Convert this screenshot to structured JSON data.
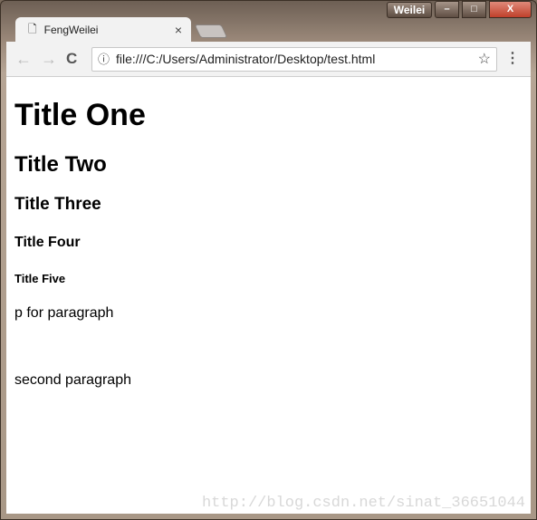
{
  "window": {
    "user": "Weilei",
    "min": "–",
    "max": "□",
    "close": "X"
  },
  "tab": {
    "title": "FengWeilei",
    "close": "×"
  },
  "toolbar": {
    "back": "←",
    "forward": "→",
    "reload": "C",
    "url": "file:///C:/Users/Administrator/Desktop/test.html",
    "info": "ⓘ",
    "star": "☆",
    "menu": "⋮"
  },
  "page": {
    "h1": "Title One",
    "h2": "Title Two",
    "h3": "Title Three",
    "h4": "Title Four",
    "h5": "Title Five",
    "p1": "p for paragraph",
    "p2": "second paragraph"
  },
  "watermark": "http://blog.csdn.net/sinat_36651044"
}
